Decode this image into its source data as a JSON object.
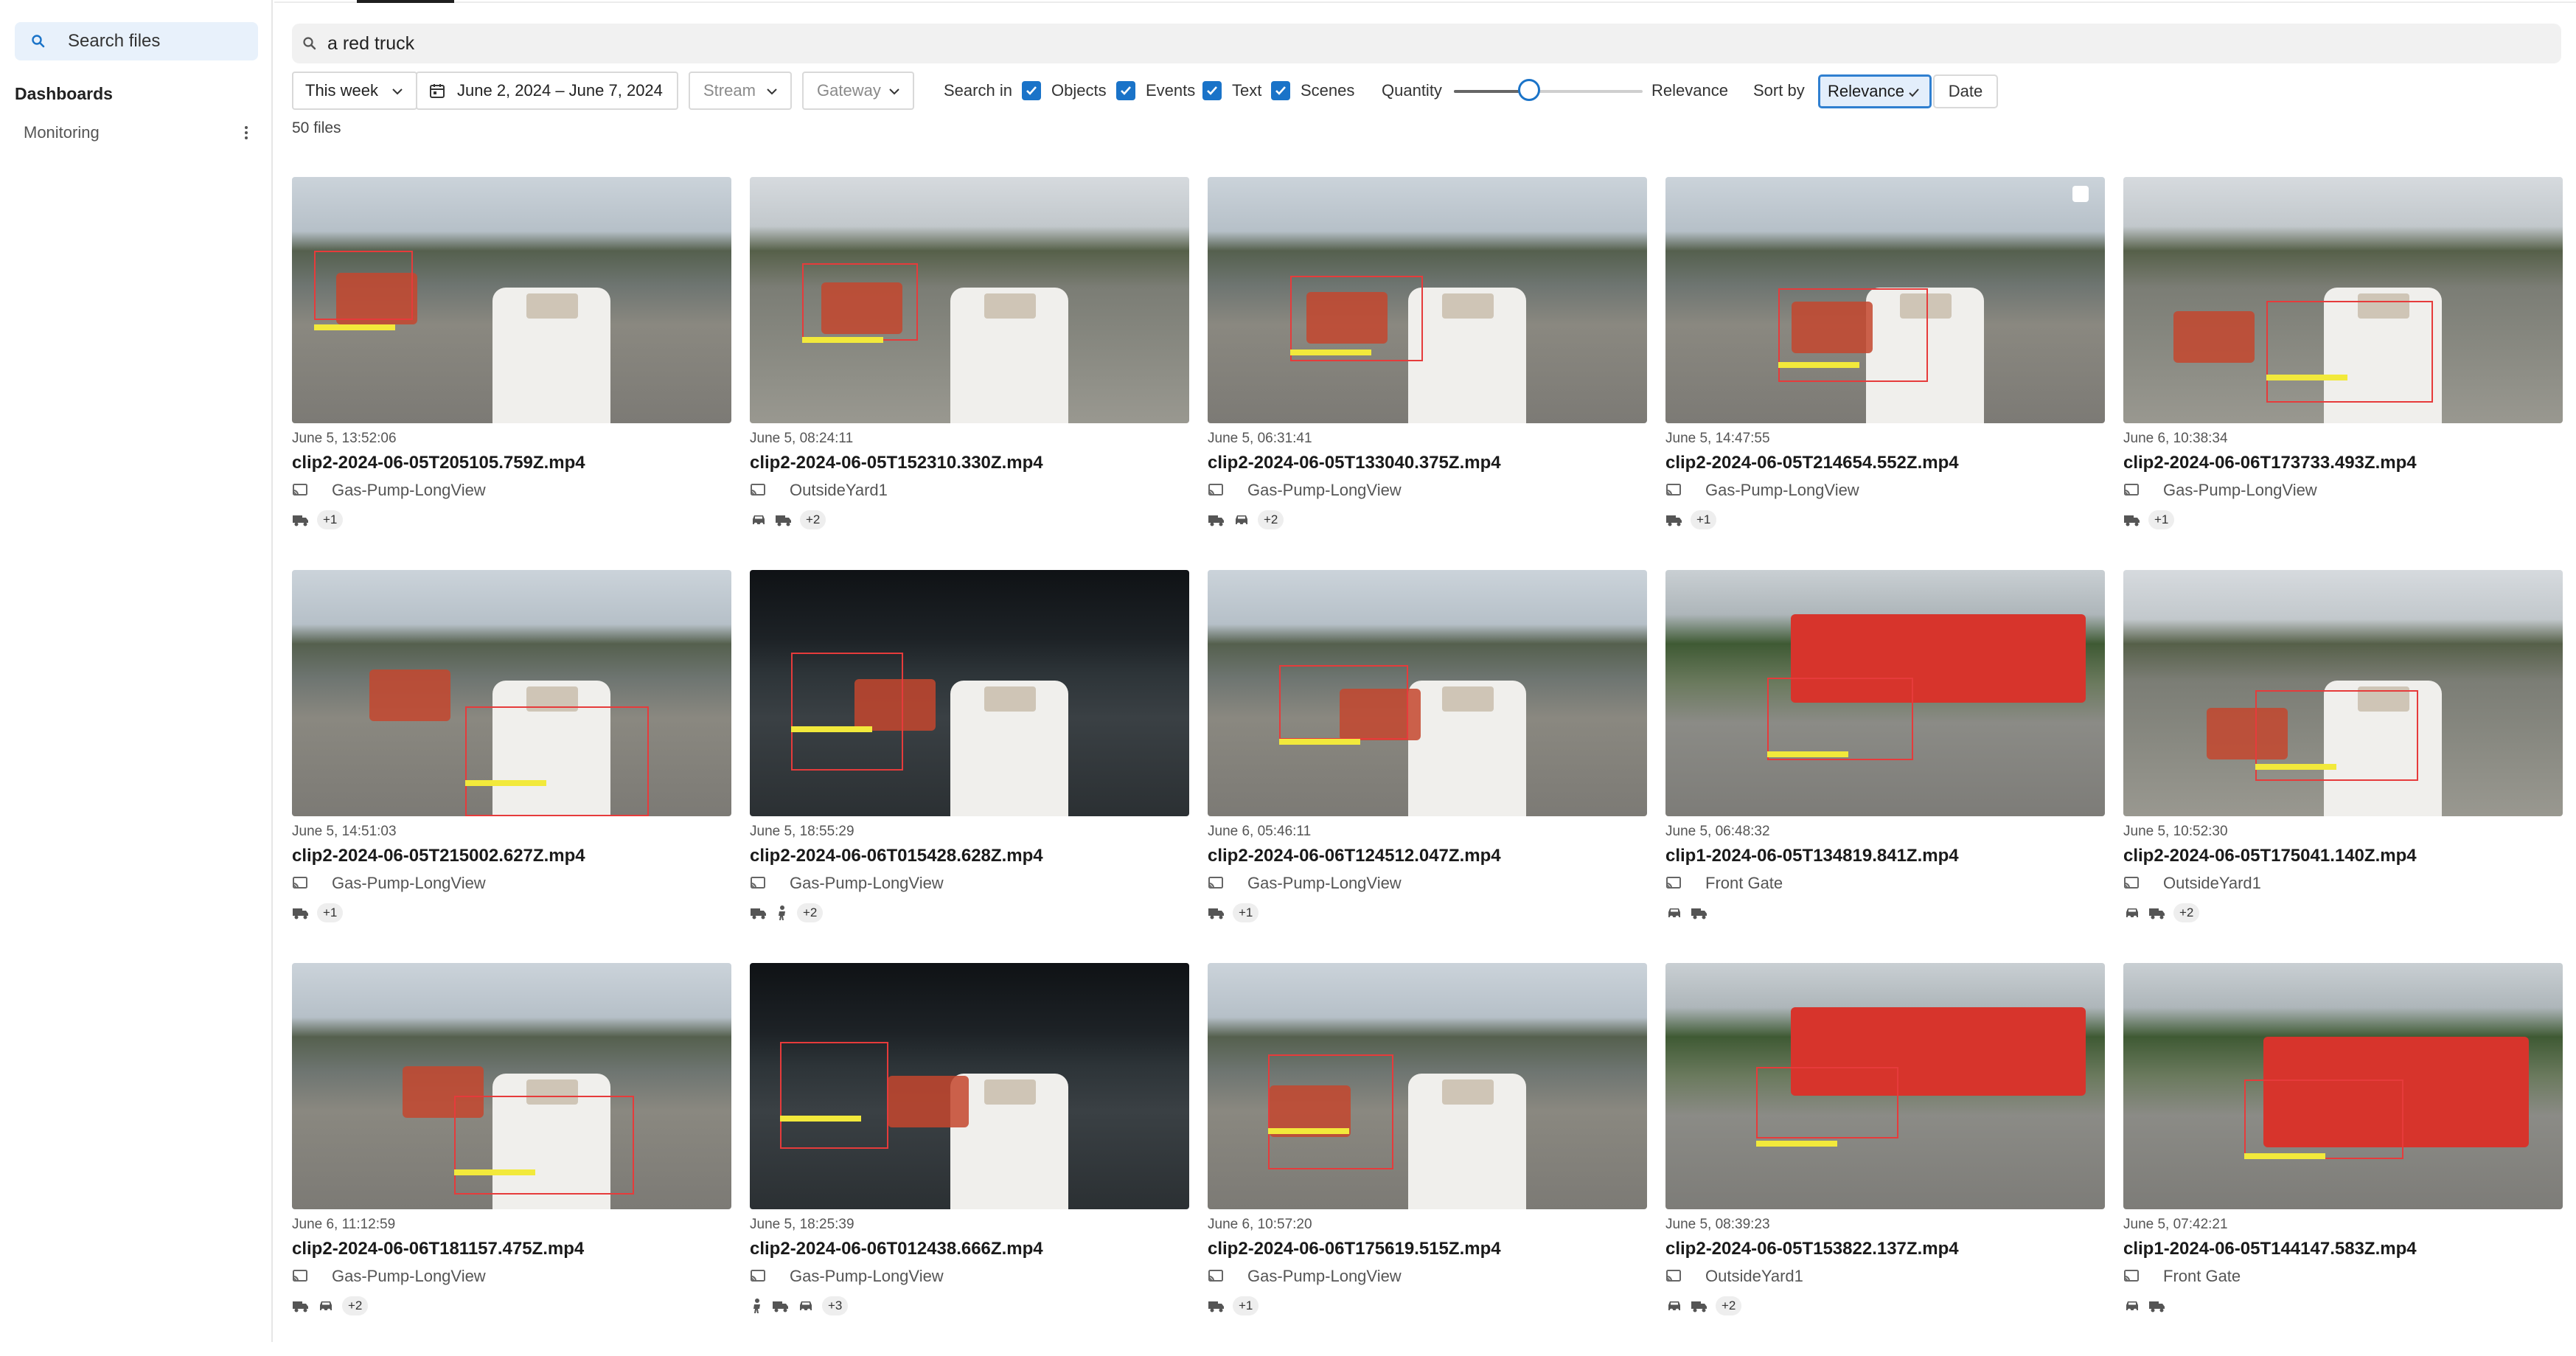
{
  "sidebar": {
    "search_label": "Search files",
    "dashboards_title": "Dashboards",
    "dashboard_items": [
      {
        "label": "Monitoring"
      }
    ]
  },
  "search": {
    "query": "a red truck"
  },
  "filters": {
    "period": "This week",
    "date_range": "June 2, 2024 – June 7, 2024",
    "stream_placeholder": "Stream",
    "gateway_placeholder": "Gateway",
    "search_in_label": "Search in",
    "search_in": [
      {
        "label": "Objects",
        "checked": true
      },
      {
        "label": "Events",
        "checked": true
      },
      {
        "label": "Text",
        "checked": true
      },
      {
        "label": "Scenes",
        "checked": true
      }
    ],
    "slider_left_label": "Quantity",
    "slider_right_label": "Relevance",
    "slider_value": 0.4,
    "sort_by_label": "Sort by",
    "sort_options": [
      "Relevance",
      "Date"
    ],
    "sort_selected": "Relevance"
  },
  "results": {
    "count_label": "50 files",
    "items": [
      {
        "time": "June 5, 13:52:06",
        "filename": "clip2-2024-06-05T205105.759Z.mp4",
        "stream": "Gas-Pump-LongView",
        "icons": [
          "truck-icon"
        ],
        "more": "+1"
      },
      {
        "time": "June 5, 08:24:11",
        "filename": "clip2-2024-06-05T152310.330Z.mp4",
        "stream": "OutsideYard1",
        "icons": [
          "car-icon",
          "truck-icon"
        ],
        "more": "+2"
      },
      {
        "time": "June 5, 06:31:41",
        "filename": "clip2-2024-06-05T133040.375Z.mp4",
        "stream": "Gas-Pump-LongView",
        "icons": [
          "truck-icon",
          "car-icon"
        ],
        "more": "+2"
      },
      {
        "time": "June 5, 14:47:55",
        "filename": "clip2-2024-06-05T214654.552Z.mp4",
        "stream": "Gas-Pump-LongView",
        "icons": [
          "truck-icon"
        ],
        "more": "+1"
      },
      {
        "time": "June 6, 10:38:34",
        "filename": "clip2-2024-06-06T173733.493Z.mp4",
        "stream": "Gas-Pump-LongView",
        "icons": [
          "truck-icon"
        ],
        "more": "+1"
      },
      {
        "time": "June 5, 14:51:03",
        "filename": "clip2-2024-06-05T215002.627Z.mp4",
        "stream": "Gas-Pump-LongView",
        "icons": [
          "truck-icon"
        ],
        "more": "+1"
      },
      {
        "time": "June 5, 18:55:29",
        "filename": "clip2-2024-06-06T015428.628Z.mp4",
        "stream": "Gas-Pump-LongView",
        "icons": [
          "truck-icon",
          "person-icon"
        ],
        "more": "+2"
      },
      {
        "time": "June 6, 05:46:11",
        "filename": "clip2-2024-06-06T124512.047Z.mp4",
        "stream": "Gas-Pump-LongView",
        "icons": [
          "truck-icon"
        ],
        "more": "+1"
      },
      {
        "time": "June 5, 06:48:32",
        "filename": "clip1-2024-06-05T134819.841Z.mp4",
        "stream": "Front Gate",
        "icons": [
          "car-icon",
          "truck-icon"
        ],
        "more": ""
      },
      {
        "time": "June 5, 10:52:30",
        "filename": "clip2-2024-06-05T175041.140Z.mp4",
        "stream": "OutsideYard1",
        "icons": [
          "car-icon",
          "truck-icon"
        ],
        "more": "+2"
      },
      {
        "time": "June 6, 11:12:59",
        "filename": "clip2-2024-06-06T181157.475Z.mp4",
        "stream": "Gas-Pump-LongView",
        "icons": [
          "truck-icon",
          "car-icon"
        ],
        "more": "+2"
      },
      {
        "time": "June 5, 18:25:39",
        "filename": "clip2-2024-06-06T012438.666Z.mp4",
        "stream": "Gas-Pump-LongView",
        "icons": [
          "person-icon",
          "truck-icon",
          "car-icon"
        ],
        "more": "+3"
      },
      {
        "time": "June 6, 10:57:20",
        "filename": "clip2-2024-06-06T175619.515Z.mp4",
        "stream": "Gas-Pump-LongView",
        "icons": [
          "truck-icon"
        ],
        "more": "+1"
      },
      {
        "time": "June 5, 08:39:23",
        "filename": "clip2-2024-06-05T153822.137Z.mp4",
        "stream": "OutsideYard1",
        "icons": [
          "car-icon",
          "truck-icon"
        ],
        "more": "+2"
      },
      {
        "time": "June 5, 07:42:21",
        "filename": "clip1-2024-06-05T144147.583Z.mp4",
        "stream": "Front Gate",
        "icons": [
          "car-icon",
          "truck-icon"
        ],
        "more": ""
      }
    ]
  },
  "colors": {
    "accent": "#1a73c8",
    "sidebar_search_bg": "#e8f1fb",
    "search_bar_bg": "#f1f1f1",
    "detection_box": "#e63b3b",
    "detection_label": "#f2e93b"
  }
}
